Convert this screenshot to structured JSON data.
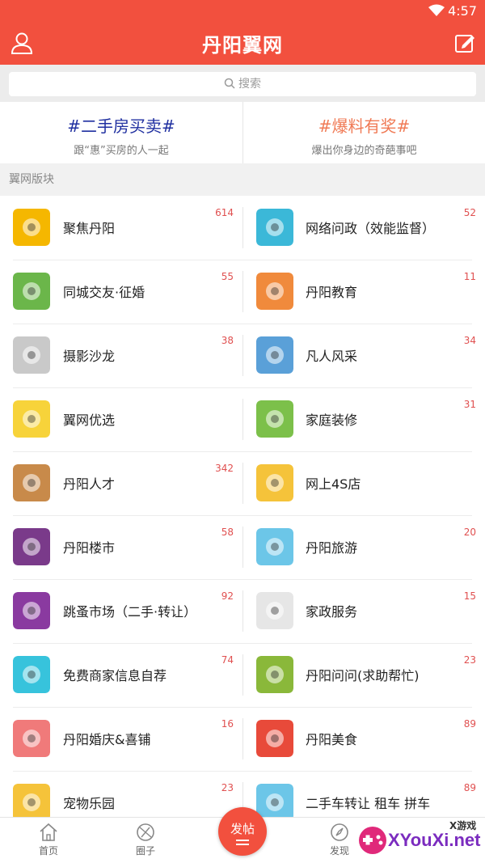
{
  "status": {
    "time": "4:57"
  },
  "header": {
    "title": "丹阳翼网"
  },
  "search": {
    "placeholder": "搜索"
  },
  "topics": [
    {
      "title": "#二手房买卖#",
      "subtitle": "跟“惠”买房的人一起",
      "color": "#1f2fa0"
    },
    {
      "title": "#爆料有奖#",
      "subtitle": "爆出你身边的奇葩事吧",
      "color": "#f07a55"
    }
  ],
  "section": {
    "title": "翼网版块"
  },
  "boards": [
    {
      "name": "聚焦丹阳",
      "count": "614",
      "icon": "phoenix-icon",
      "color": "#f5b700"
    },
    {
      "name": "网络问政（效能监督）",
      "count": "52",
      "icon": "eye-icon",
      "color": "#3bb8d8"
    },
    {
      "name": "同城交友·征婚",
      "count": "55",
      "icon": "heart-handshake-icon",
      "color": "#6bb64a"
    },
    {
      "name": "丹阳教育",
      "count": "11",
      "icon": "blackboard-icon",
      "color": "#f08a3c"
    },
    {
      "name": "摄影沙龙",
      "count": "38",
      "icon": "camera-icon",
      "color": "#c9c9c9"
    },
    {
      "name": "凡人风采",
      "count": "34",
      "icon": "book-icon",
      "color": "#5aa0d8"
    },
    {
      "name": "翼网优选",
      "count": "",
      "icon": "brand-logo-icon",
      "color": "#f7d33a"
    },
    {
      "name": "家庭装修",
      "count": "31",
      "icon": "paint-bucket-icon",
      "color": "#7cc04a"
    },
    {
      "name": "丹阳人才",
      "count": "342",
      "icon": "graduation-cap-icon",
      "color": "#c88a4a"
    },
    {
      "name": "网上4S店",
      "count": "",
      "icon": "car-icon",
      "color": "#f5c33a"
    },
    {
      "name": "丹阳楼市",
      "count": "58",
      "icon": "building-icon",
      "color": "#7a3a8a"
    },
    {
      "name": "丹阳旅游",
      "count": "20",
      "icon": "airplane-icon",
      "color": "#6cc6e8"
    },
    {
      "name": "跳蚤市场（二手·转让）",
      "count": "92",
      "icon": "shopping-bags-icon",
      "color": "#8a3aa0"
    },
    {
      "name": "家政服务",
      "count": "15",
      "icon": "broom-icon",
      "color": "#e6e6e6"
    },
    {
      "name": "免费商家信息自荐",
      "count": "74",
      "icon": "speaker-icon",
      "color": "#37c3dc"
    },
    {
      "name": "丹阳问问(求助帮忙)",
      "count": "23",
      "icon": "question-bubble-icon",
      "color": "#8ab83a"
    },
    {
      "name": "丹阳婚庆&喜铺",
      "count": "16",
      "icon": "bed-heart-icon",
      "color": "#f07a7a"
    },
    {
      "name": "丹阳美食",
      "count": "89",
      "icon": "plate-cutlery-icon",
      "color": "#e84a3a"
    },
    {
      "name": "宠物乐园",
      "count": "23",
      "icon": "dog-icon",
      "color": "#f5c33a"
    },
    {
      "name": "二手车转让 租车 拼车",
      "count": "89",
      "icon": "red-car-icon",
      "color": "#6cc6e8"
    }
  ],
  "tabs": [
    {
      "label": "首页",
      "icon": "home-icon"
    },
    {
      "label": "圈子",
      "icon": "circle-icon"
    },
    {
      "label": "发帖",
      "icon": "post-icon"
    },
    {
      "label": "发现",
      "icon": "compass-icon"
    }
  ],
  "watermark": {
    "big": "XYouXi.net",
    "small": "X游戏"
  },
  "theme": {
    "accent": "#f2503e"
  }
}
